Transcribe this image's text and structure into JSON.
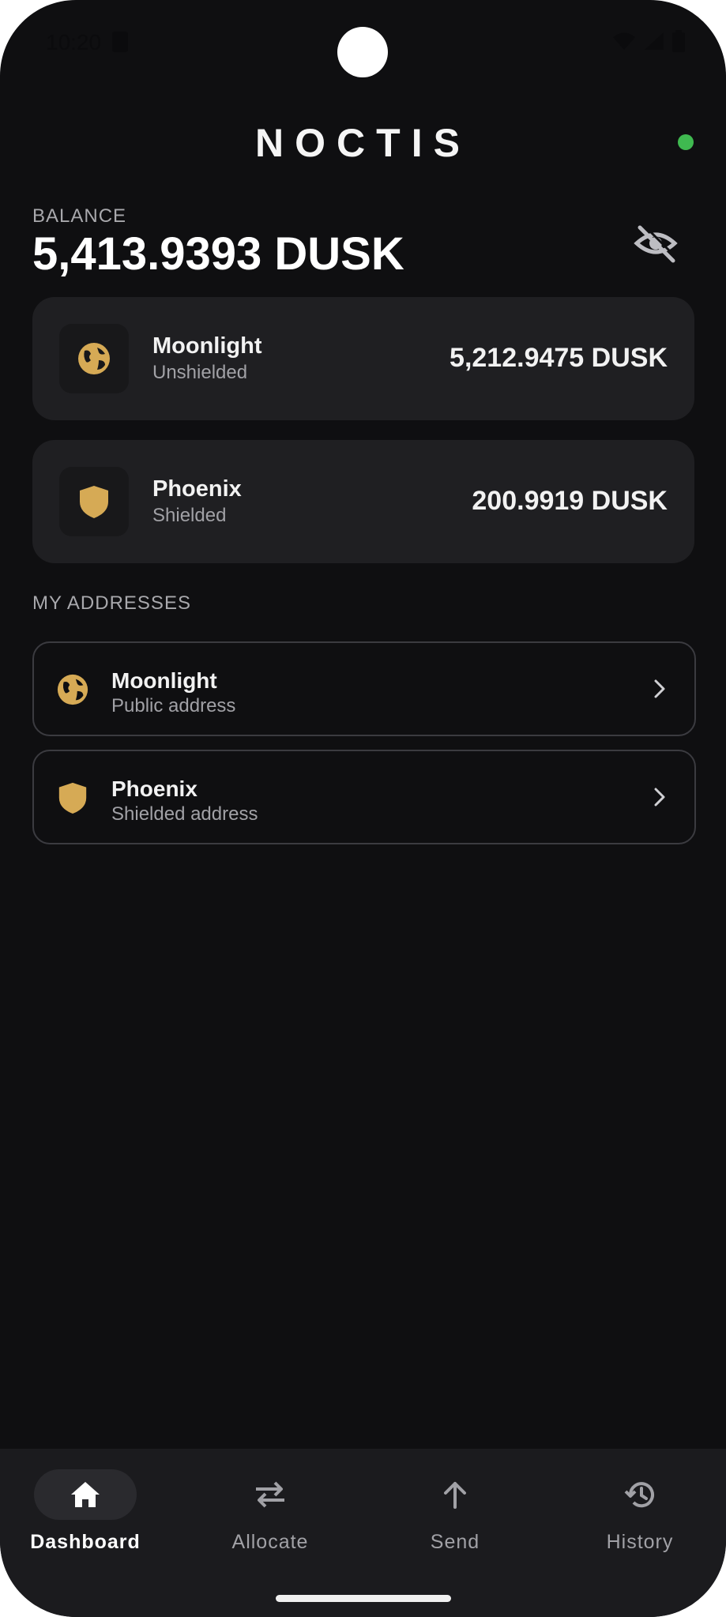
{
  "status_bar": {
    "time": "10:20"
  },
  "header": {
    "title": "NOCTIS",
    "status_color": "#3fb950"
  },
  "balance": {
    "label": "BALANCE",
    "value": "5,413.9393 DUSK"
  },
  "accounts": [
    {
      "name": "Moonlight",
      "type": "Unshielded",
      "amount": "5,212.9475 DUSK",
      "icon": "globe-icon"
    },
    {
      "name": "Phoenix",
      "type": "Shielded",
      "amount": "200.9919 DUSK",
      "icon": "shield-icon"
    }
  ],
  "addresses_section": {
    "label": "MY ADDRESSES",
    "items": [
      {
        "name": "Moonlight",
        "sub": "Public address",
        "icon": "globe-icon"
      },
      {
        "name": "Phoenix",
        "sub": "Shielded address",
        "icon": "shield-icon"
      }
    ]
  },
  "nav": {
    "items": [
      {
        "label": "Dashboard",
        "icon": "home-icon",
        "active": true
      },
      {
        "label": "Allocate",
        "icon": "swap-icon",
        "active": false
      },
      {
        "label": "Send",
        "icon": "arrow-up-icon",
        "active": false
      },
      {
        "label": "History",
        "icon": "history-icon",
        "active": false
      }
    ]
  },
  "colors": {
    "accent": "#d6aa55",
    "background": "#0f0f11",
    "card": "#1f1f22"
  }
}
